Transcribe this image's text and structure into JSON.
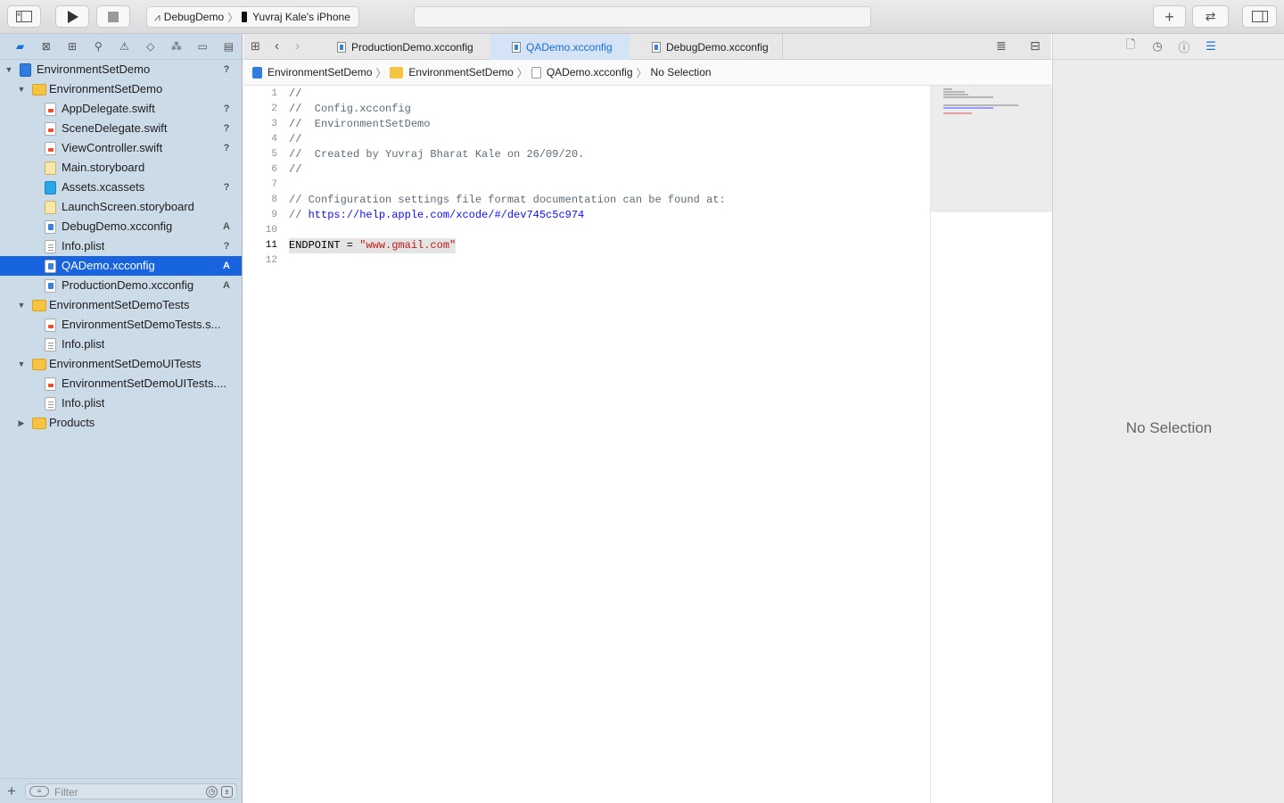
{
  "toolbar": {
    "scheme_target": "DebugDemo",
    "scheme_device": "Yuvraj  Kale's iPhone"
  },
  "navigator": {
    "items": [
      {
        "label": "EnvironmentSetDemo",
        "badge": "?",
        "level": 0,
        "icon": "project-icon",
        "disclosure": "open"
      },
      {
        "label": "EnvironmentSetDemo",
        "badge": "",
        "level": 1,
        "icon": "folder-icon",
        "disclosure": "open"
      },
      {
        "label": "AppDelegate.swift",
        "badge": "?",
        "level": 2,
        "icon": "swift-file-icon",
        "disclosure": ""
      },
      {
        "label": "SceneDelegate.swift",
        "badge": "?",
        "level": 2,
        "icon": "swift-file-icon",
        "disclosure": ""
      },
      {
        "label": "ViewController.swift",
        "badge": "?",
        "level": 2,
        "icon": "swift-file-icon",
        "disclosure": ""
      },
      {
        "label": "Main.storyboard",
        "badge": "",
        "level": 2,
        "icon": "storyboard-icon",
        "disclosure": ""
      },
      {
        "label": "Assets.xcassets",
        "badge": "?",
        "level": 2,
        "icon": "assets-icon",
        "disclosure": ""
      },
      {
        "label": "LaunchScreen.storyboard",
        "badge": "",
        "level": 2,
        "icon": "storyboard-icon",
        "disclosure": ""
      },
      {
        "label": "DebugDemo.xcconfig",
        "badge": "A",
        "level": 2,
        "icon": "xcconfig-icon",
        "disclosure": ""
      },
      {
        "label": "Info.plist",
        "badge": "?",
        "level": 2,
        "icon": "plist-icon",
        "disclosure": ""
      },
      {
        "label": "QADemo.xcconfig",
        "badge": "A",
        "level": 2,
        "icon": "xcconfig-icon",
        "disclosure": "",
        "selected": true
      },
      {
        "label": "ProductionDemo.xcconfig",
        "badge": "A",
        "level": 2,
        "icon": "xcconfig-icon",
        "disclosure": ""
      },
      {
        "label": "EnvironmentSetDemoTests",
        "badge": "",
        "level": 1,
        "icon": "folder-icon",
        "disclosure": "open"
      },
      {
        "label": "EnvironmentSetDemoTests.s...",
        "badge": "",
        "level": 2,
        "icon": "swift-file-icon",
        "disclosure": ""
      },
      {
        "label": "Info.plist",
        "badge": "",
        "level": 2,
        "icon": "plist-icon",
        "disclosure": ""
      },
      {
        "label": "EnvironmentSetDemoUITests",
        "badge": "",
        "level": 1,
        "icon": "folder-icon",
        "disclosure": "open"
      },
      {
        "label": "EnvironmentSetDemoUITests....",
        "badge": "",
        "level": 2,
        "icon": "swift-file-icon",
        "disclosure": ""
      },
      {
        "label": "Info.plist",
        "badge": "",
        "level": 2,
        "icon": "plist-icon",
        "disclosure": ""
      },
      {
        "label": "Products",
        "badge": "",
        "level": 1,
        "icon": "folder-icon",
        "disclosure": "closed"
      }
    ],
    "filter_placeholder": "Filter"
  },
  "tabs": [
    {
      "label": "ProductionDemo.xcconfig",
      "active": false
    },
    {
      "label": "QADemo.xcconfig",
      "active": true
    },
    {
      "label": "DebugDemo.xcconfig",
      "active": false
    }
  ],
  "jumpbar": {
    "project": "EnvironmentSetDemo",
    "group": "EnvironmentSetDemo",
    "file": "QADemo.xcconfig",
    "symbol": "No Selection"
  },
  "code": {
    "current_line": 11,
    "lines": [
      {
        "n": "1",
        "text": "//"
      },
      {
        "n": "2",
        "text": "//  Config.xcconfig"
      },
      {
        "n": "3",
        "text": "//  EnvironmentSetDemo"
      },
      {
        "n": "4",
        "text": "//"
      },
      {
        "n": "5",
        "text": "//  Created by Yuvraj Bharat Kale on 26/09/20."
      },
      {
        "n": "6",
        "text": "//"
      },
      {
        "n": "7",
        "text": ""
      },
      {
        "n": "8",
        "text": "// Configuration settings file format documentation can be found at:"
      },
      {
        "n": "9",
        "text": "// ",
        "link": "https://help.apple.com/xcode/#/dev745c5c974"
      },
      {
        "n": "10",
        "text": ""
      },
      {
        "n": "11",
        "text": "ENDPOINT = ",
        "string": "\"www.gmail.com\""
      },
      {
        "n": "12",
        "text": ""
      }
    ]
  },
  "inspector": {
    "empty_label": "No Selection"
  },
  "colors": {
    "navigator_bg": "#ccdbe8",
    "selection": "#1864e0",
    "accent": "#1a6fd8",
    "string": "#c41a16",
    "link": "#0e0eff"
  }
}
